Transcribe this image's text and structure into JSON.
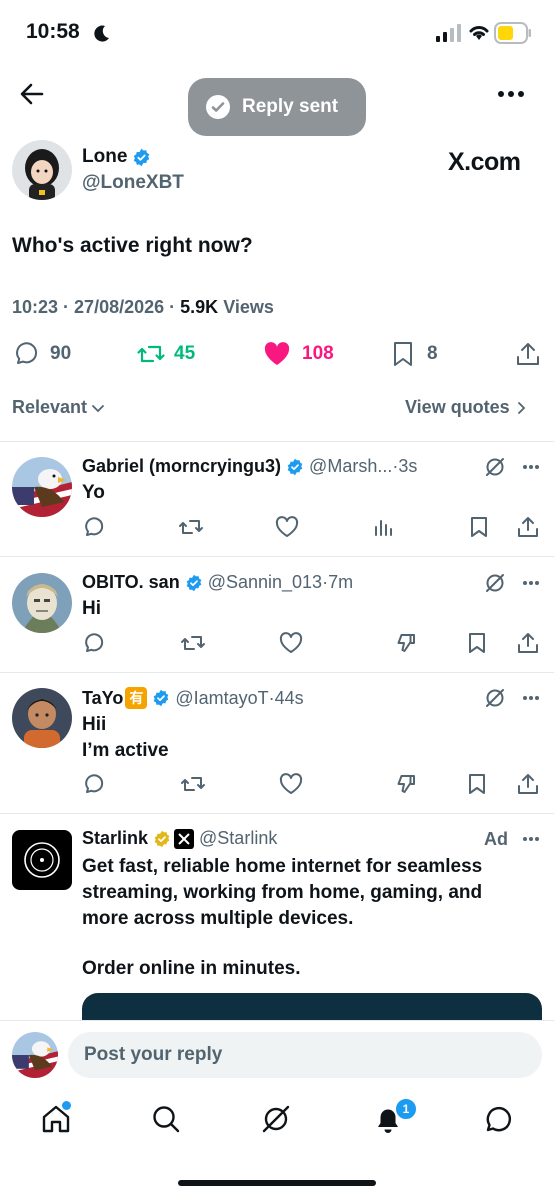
{
  "status_bar": {
    "time": "10:58"
  },
  "toast": {
    "text": "Reply sent"
  },
  "post": {
    "author_name": "Lone",
    "handle": "@LoneXBT",
    "watermark": "X.com",
    "text": "Who's active right now?",
    "time": "10:23",
    "date": "27/08/2026",
    "views_count": "5.9K",
    "views_label": "Views",
    "stats": {
      "replies": "90",
      "reposts": "45",
      "likes": "108",
      "bookmarks": "8"
    }
  },
  "filters": {
    "sort_label": "Relevant",
    "quotes_label": "View quotes"
  },
  "replies": [
    {
      "name": "Gabriel (morncryingu3)",
      "handle": "@Marsh...",
      "time": "3s",
      "text": "Yo"
    },
    {
      "name": "OBITO. san",
      "handle": "@Sannin_013",
      "time": "7m",
      "text": "Hi"
    },
    {
      "name": "TaYo",
      "badge": "有",
      "handle": "@IamtayoT",
      "time": "44s",
      "text": "Hii",
      "text2": "I’m active"
    }
  ],
  "ad": {
    "name": "Starlink",
    "handle": "@Starlink",
    "label": "Ad",
    "text": "Get fast, reliable home internet for seamless streaming, working from home, gaming, and more across multiple devices.",
    "text2": "Order online in minutes."
  },
  "composer": {
    "placeholder": "Post your reply"
  },
  "tab_bar": {
    "notifications_badge": "1"
  },
  "colors": {
    "repost_green": "#00ba7c",
    "like_pink": "#f91880",
    "verified_blue": "#1d9bf0",
    "gold": "#e2b719"
  }
}
